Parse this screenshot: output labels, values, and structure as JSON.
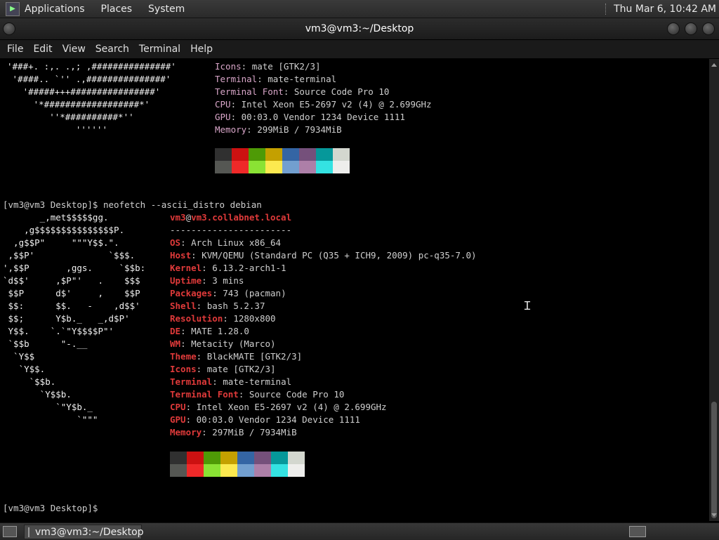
{
  "top_panel": {
    "menus": [
      "Applications",
      "Places",
      "System"
    ],
    "clock": "Thu Mar  6, 10:42 AM"
  },
  "window": {
    "title": "vm3@vm3:~/Desktop",
    "menubar": [
      "File",
      "Edit",
      "View",
      "Search",
      "Terminal",
      "Help"
    ]
  },
  "terminal": {
    "art1": [
      "'###+. :,. .,; ,###############'",
      " '####.. `'' .,###############'",
      "   '#####+++################'",
      "     '*##################*'",
      "        ''*##########*''",
      "             ''''''"
    ],
    "info1": [
      {
        "k": "Icons",
        "v": "mate [GTK2/3]"
      },
      {
        "k": "Terminal",
        "v": "mate-terminal"
      },
      {
        "k": "Terminal Font",
        "v": "Source Code Pro 10"
      },
      {
        "k": "CPU",
        "v": "Intel Xeon E5-2697 v2 (4) @ 2.699GHz"
      },
      {
        "k": "GPU",
        "v": "00:03.0 Vendor 1234 Device 1111"
      },
      {
        "k": "Memory",
        "v": "299MiB / 7934MiB"
      }
    ],
    "prompt1": "[vm3@vm3 Desktop]$ neofetch --ascii_distro debian",
    "art2": [
      "       _,met$$$$$gg.",
      "    ,g$$$$$$$$$$$$$$$P.",
      "  ,g$$P\"     \"\"\"Y$$.\".",
      " ,$$P'              `$$$.",
      "',$$P       ,ggs.     `$$b:",
      "`d$$'     ,$P\"'   .    $$$",
      " $$P      d$'     ,    $$P",
      " $$:      $$.   -    ,d$$'",
      " $$;      Y$b._   _,d$P'",
      " Y$$.    `.`\"Y$$$$P\"'",
      " `$$b      \"-.__",
      "  `Y$$",
      "   `Y$$.",
      "     `$$b.",
      "       `Y$$b.",
      "          `\"Y$b._",
      "              `\"\"\""
    ],
    "user": "vm3",
    "at": "@",
    "host": "vm3.collabnet.local",
    "separator": "-----------------------",
    "info2": [
      {
        "k": "OS",
        "v": "Arch Linux x86_64"
      },
      {
        "k": "Host",
        "v": "KVM/QEMU (Standard PC (Q35 + ICH9, 2009) pc-q35-7.0)"
      },
      {
        "k": "Kernel",
        "v": "6.13.2-arch1-1"
      },
      {
        "k": "Uptime",
        "v": "3 mins"
      },
      {
        "k": "Packages",
        "v": "743 (pacman)"
      },
      {
        "k": "Shell",
        "v": "bash 5.2.37"
      },
      {
        "k": "Resolution",
        "v": "1280x800"
      },
      {
        "k": "DE",
        "v": "MATE 1.28.0"
      },
      {
        "k": "WM",
        "v": "Metacity (Marco)"
      },
      {
        "k": "Theme",
        "v": "BlackMATE [GTK2/3]"
      },
      {
        "k": "Icons",
        "v": "mate [GTK2/3]"
      },
      {
        "k": "Terminal",
        "v": "mate-terminal"
      },
      {
        "k": "Terminal Font",
        "v": "Source Code Pro 10"
      },
      {
        "k": "CPU",
        "v": "Intel Xeon E5-2697 v2 (4) @ 2.699GHz"
      },
      {
        "k": "GPU",
        "v": "00:03.0 Vendor 1234 Device 1111"
      },
      {
        "k": "Memory",
        "v": "297MiB / 7934MiB"
      }
    ],
    "prompt2": "[vm3@vm3 Desktop]$",
    "palette_dark": [
      "#303030",
      "#cc1111",
      "#4e9a06",
      "#c4a000",
      "#3465a4",
      "#75507b",
      "#06989a",
      "#d3d7cf"
    ],
    "palette_bright": [
      "#555753",
      "#ef2929",
      "#8ae234",
      "#fce94f",
      "#729fcf",
      "#ad7fa8",
      "#34e2e2",
      "#eeeeec"
    ]
  },
  "bottom_panel": {
    "task_label": "vm3@vm3:~/Desktop"
  },
  "colors": {
    "label_pink": "#d9a6c9",
    "label_red": "#e03a3a"
  }
}
